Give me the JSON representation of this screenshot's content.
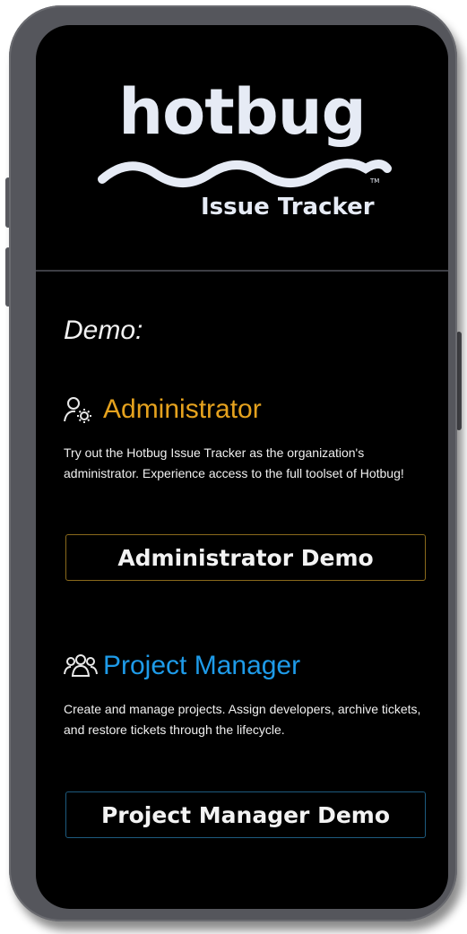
{
  "logo": {
    "word": "hotbug",
    "subtitle": "Issue Tracker",
    "tm": "TM"
  },
  "demo": {
    "heading": "Demo:",
    "roles": [
      {
        "title": "Administrator",
        "icon": "user-gear-icon",
        "color": "#e5a21e",
        "description": "Try out the Hotbug Issue Tracker as the organization's administrator. Experience access to the full toolset of Hotbug!",
        "button_label": "Administrator Demo",
        "button_border": "#8a6a1c"
      },
      {
        "title": "Project Manager",
        "icon": "users-group-icon",
        "color": "#1e9be9",
        "description": "Create and manage projects. Assign developers, archive tickets, and restore tickets through the lifecycle.",
        "button_label": "Project Manager Demo",
        "button_border": "#1d5a7e"
      }
    ]
  },
  "colors": {
    "background": "#000000",
    "frame": "#55565c",
    "logo": "#e6ebf5"
  }
}
